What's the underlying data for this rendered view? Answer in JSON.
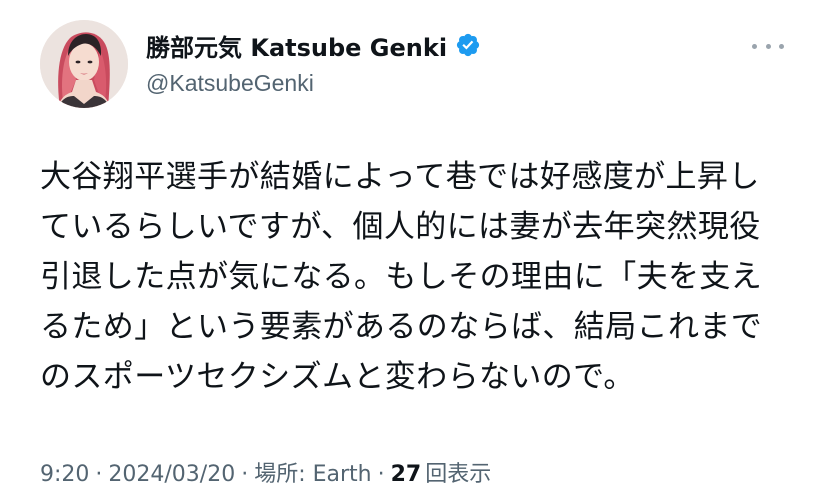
{
  "author": {
    "display_name": "勝部元気 Katsube Genki",
    "handle": "@KatsubeGenki",
    "verified": true
  },
  "icons": {
    "avatar": "profile-photo",
    "verified": "verified-badge-icon",
    "more": "more-options-icon"
  },
  "colors": {
    "verified_badge": "#1d9bf0",
    "text": "#0f1419",
    "secondary": "#536471"
  },
  "tweet": {
    "lines": [
      "大谷翔平選手が結婚によって巷では好感度が上昇し",
      "ているらしいですが、個人的には妻が去年突然現役",
      "引退した点が気になる。もしその理由に「夫を支え",
      "るため」という要素があるのならば、結局これまで",
      "のスポーツセクシズムと変わらないので。"
    ]
  },
  "meta": {
    "time": "9:20",
    "date": "2024/03/20",
    "location": "場所: Earth",
    "views_count": "27",
    "views_label": "回表示",
    "separator": "·"
  }
}
